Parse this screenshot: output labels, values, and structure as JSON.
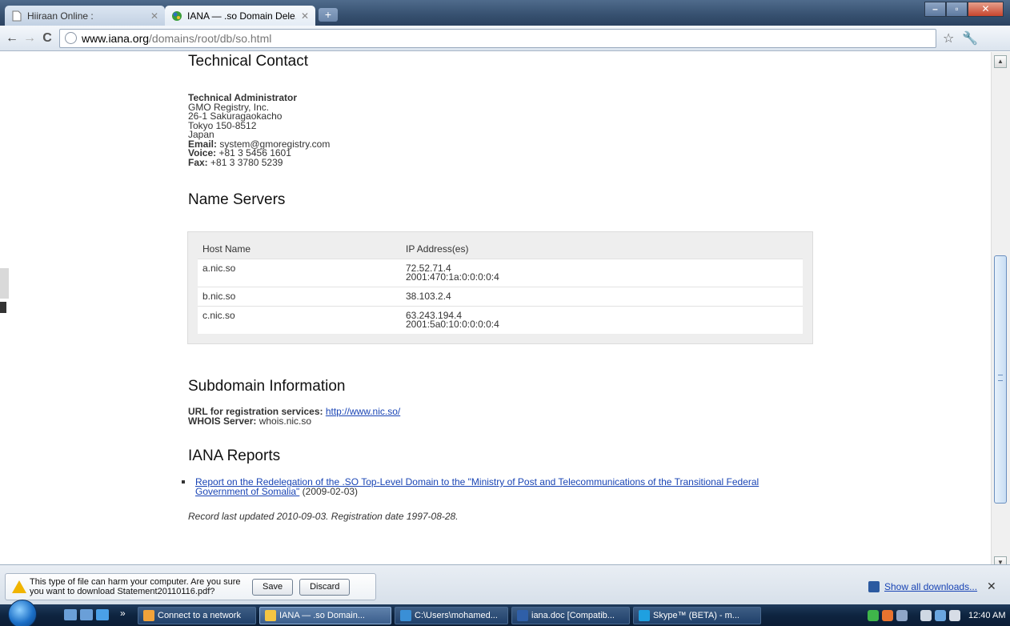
{
  "browser": {
    "tabs": [
      {
        "title": "Hiiraan Online :",
        "active": false
      },
      {
        "title": "IANA — .so Domain Dele...",
        "active": true
      }
    ],
    "new_tab_label": "+",
    "url_host": "www.iana.org",
    "url_path": "/domains/root/db/so.html"
  },
  "page": {
    "technical_contact": {
      "heading": "Technical Contact",
      "role": "Technical Administrator",
      "org": "GMO Registry, Inc.",
      "address1": "26-1 Sakuragaokacho",
      "address2": "Tokyo 150-8512",
      "country": "Japan",
      "email_label": "Email:",
      "email": "system@gmoregistry.com",
      "voice_label": "Voice:",
      "voice": "+81 3 5456 1601",
      "fax_label": "Fax:",
      "fax": "+81 3 3780 5239"
    },
    "name_servers": {
      "heading": "Name Servers",
      "col_host": "Host Name",
      "col_ip": "IP Address(es)",
      "rows": [
        {
          "host": "a.nic.so",
          "ip1": "72.52.71.4",
          "ip2": "2001:470:1a:0:0:0:0:4"
        },
        {
          "host": "b.nic.so",
          "ip1": "38.103.2.4",
          "ip2": ""
        },
        {
          "host": "c.nic.so",
          "ip1": "63.243.194.4",
          "ip2": "2001:5a0:10:0:0:0:0:4"
        }
      ]
    },
    "subdomain": {
      "heading": "Subdomain Information",
      "url_label": "URL for registration services:",
      "url": "http://www.nic.so/",
      "whois_label": "WHOIS Server:",
      "whois": "whois.nic.so"
    },
    "reports": {
      "heading": "IANA Reports",
      "link_line1": "Report on the Redelegation of the .SO Top-Level Domain to the \"Ministry of Post and Telecommunications of the Transitional Federal",
      "link_line2": "Government of Somalia\"",
      "date": " (2009-02-03)"
    },
    "record_note": "Record last updated 2010-09-03. Registration date 1997-08-28."
  },
  "download_shelf": {
    "warning_line1": "This type of file can harm your computer. Are you sure",
    "warning_line2": "you want to download Statement20110116.pdf?",
    "save_label": "Save",
    "discard_label": "Discard",
    "show_all_label": "Show all downloads...",
    "close_label": "✕"
  },
  "taskbar": {
    "items": [
      {
        "label": "Connect to a network",
        "color": "#f2a33a"
      },
      {
        "label": "IANA — .so Domain...",
        "color": "#f4c542"
      },
      {
        "label": "C:\\Users\\mohamed...",
        "color": "#3a8fd6"
      },
      {
        "label": "iana.doc [Compatib...",
        "color": "#2f5fa8"
      },
      {
        "label": "Skype™ (BETA) - m...",
        "color": "#1fa0e0"
      }
    ],
    "clock": "12:40 AM"
  },
  "colors": {
    "link": "#1a45b5",
    "titlebar": "#36506f",
    "close_button": "#c8452e"
  }
}
